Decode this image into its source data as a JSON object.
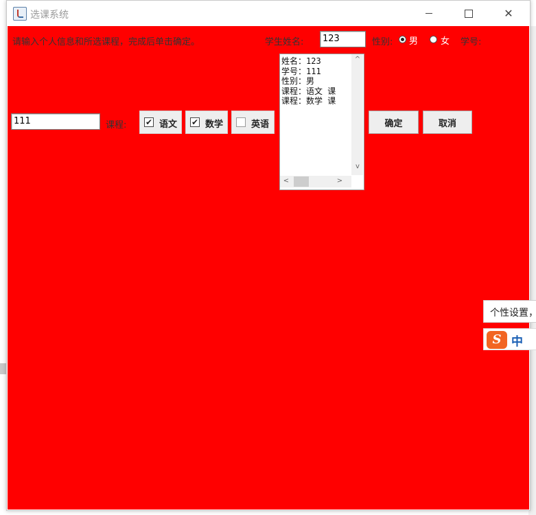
{
  "window": {
    "title": "选课系统"
  },
  "form": {
    "prompt": "请输入个人信息和所选课程，完成后单击确定。",
    "name_label": "学生姓名:",
    "name_value": "123",
    "gender_label": "性别:",
    "gender_male": "男",
    "gender_female": "女",
    "gender_selected": "男",
    "id_label": "学号:",
    "id_value": "111",
    "course_label": "课程:",
    "courses": [
      {
        "label": "语文",
        "checked": true
      },
      {
        "label": "数学",
        "checked": true
      },
      {
        "label": "英语",
        "checked": false
      }
    ],
    "ok_button": "确定",
    "cancel_button": "取消"
  },
  "output": {
    "lines": [
      "姓名：123",
      "学号：111",
      "性别：男",
      "课程：语文 课",
      "课程：数学 课"
    ]
  },
  "ime": {
    "tooltip": "个性设置，",
    "logo": "S",
    "mode": "中"
  },
  "colors": {
    "content_background": "#ff0000",
    "ime_logo": "#f26522"
  },
  "icons": {
    "checkmark": "✔",
    "scroll_left": "<",
    "scroll_right": ">",
    "scroll_up": "^",
    "scroll_down": "v",
    "close": "✕"
  }
}
